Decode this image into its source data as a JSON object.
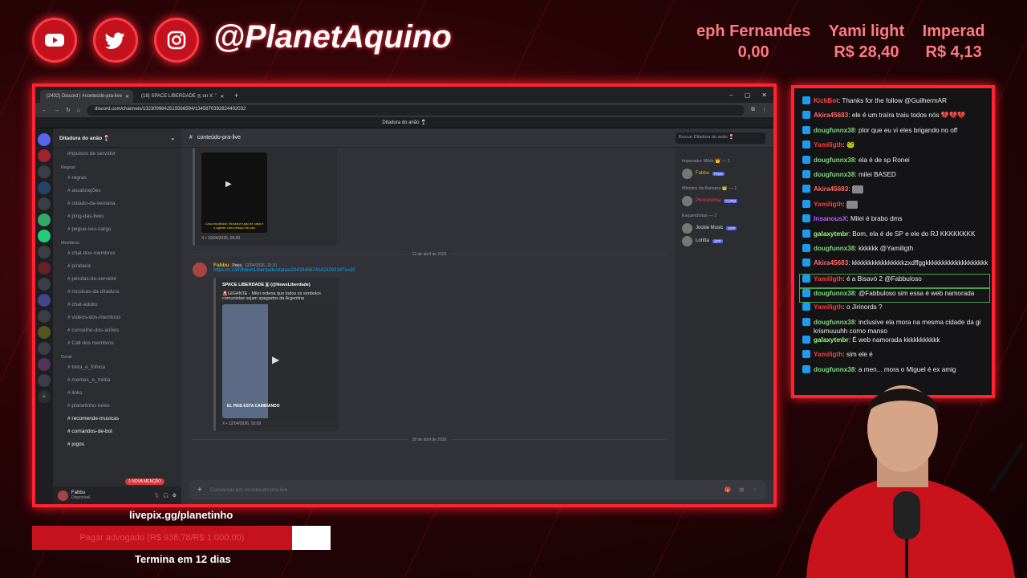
{
  "socials": [
    "youtube-icon",
    "twitter-icon",
    "instagram-icon"
  ],
  "handle": "@PlanetAquino",
  "ticker": [
    {
      "name": "eph Fernandes",
      "amount": "0,00"
    },
    {
      "name": "Yami light",
      "amount": "R$ 28,40"
    },
    {
      "name": "Imperad",
      "amount": "R$ 4,13"
    }
  ],
  "browser": {
    "tabs": [
      "(2402) Discord | #conteúdo-pra-live",
      "(18) SPACE LIBERDADE 🇦 on X: \""
    ],
    "url": "discord.com/channels/1323099842515566594/1345670392824402032",
    "title": "Ditadura do anão 🍷"
  },
  "discord": {
    "guild": "Ditadura do anão 🍷",
    "boost": "Impulsos de servidor",
    "categories": [
      {
        "name": "Regras",
        "channels": [
          "regras",
          "atualizações",
          "odiado-da-semana",
          "ping-das-lives",
          "pegue-seu-cargo"
        ]
      },
      {
        "name": "Membros",
        "channels": [
          "chat-dos-membros",
          "pirataria",
          "pérolas-do-servidor",
          "músicas-da-ditadura",
          "chat-adulto",
          "vídeos-dos-membros",
          "conselho-dos-anões",
          "Call dos membros"
        ]
      },
      {
        "name": "Geral",
        "channels": [
          "treta_e_fofoca",
          "memes_e_mídia",
          "links",
          "planetinho-news",
          "recomende-musicas",
          "comandos-de-bot",
          "jogos"
        ]
      }
    ],
    "mention": "1 NOVA MENÇÃO",
    "user": {
      "name": "Fabbu",
      "status": "Disponível"
    },
    "channel": "conteúdo-pra-live",
    "search": "Buscar Ditadura do anão 🍷",
    "messages": {
      "embed1_caption": "Caso insolitado: Morador fugiu de casa e o agente com pedaço de pau",
      "embed1_footer": "X • 10/04/2026, 09:00",
      "date1": "12 de abril de 2026",
      "author": "Fabbu",
      "tag": "Pepa",
      "time": "12/04/2026, 11:10",
      "link": "https://x.com/NewsLiberdade/status/2043345674142429214?s=20",
      "embed_title": "SPACE LIBERDADE 🇦 (@NewsLiberdade)",
      "embed_text": "🚨GIGANTE - Milei ordena que todos os símbolos comunistas sejam apagados da Argentina",
      "image_caption": "EL PAIS ESTA CAMBIANDO",
      "embed2_footer": "X • 12/04/2026, 10:09",
      "date2": "18 de abril de 2026"
    },
    "composer": "Conversar em #conteúdo-pra-live",
    "member_groups": [
      {
        "title": "Imperador Mildo 👑 — 1",
        "members": [
          {
            "name": "Fabbu",
            "tag": "Pepa",
            "color": "#f0b232"
          }
        ]
      },
      {
        "title": "Ministro da Baixaria 👑 — 1",
        "members": [
          {
            "name": "Princesinha",
            "tag": "CLRM",
            "color": "#f23f42"
          }
        ]
      },
      {
        "title": "Esquerdistas — 2",
        "members": [
          {
            "name": "Jockie Music",
            "tag": "APP",
            "color": "#dbdee1"
          },
          {
            "name": "Loritta",
            "tag": "APP",
            "color": "#dbdee1"
          }
        ]
      }
    ]
  },
  "chat": [
    {
      "user": "KickBot",
      "color": "#ff4a4a",
      "text": "Thanks for the follow @GuilhermAR"
    },
    {
      "user": "Akira45683",
      "color": "#ff6a6a",
      "text": "ele é um traíra traiu todos nós 💔💔💔"
    },
    {
      "user": "dougfunnx38",
      "color": "#7ed87e",
      "text": "plor que eu vi eles brigando no off"
    },
    {
      "user": "Yamiligth",
      "color": "#ff3a3a",
      "text": "🐸"
    },
    {
      "user": "dougfunnx38",
      "color": "#7ed87e",
      "text": "ela é de sp Ronei"
    },
    {
      "user": "dougfunnx38",
      "color": "#7ed87e",
      "text": "milei BASED"
    },
    {
      "user": "Akira45683",
      "color": "#ff6a6a",
      "text": ""
    },
    {
      "user": "Yamiligth",
      "color": "#ff3a3a",
      "text": ""
    },
    {
      "user": "InsanousX",
      "color": "#b45cff",
      "text": "Milei é brabo dms"
    },
    {
      "user": "galaxytmbr",
      "color": "#9aff7a",
      "text": "Bom, ela é de SP e ele do RJ KKKKKKKK"
    },
    {
      "user": "dougfunnx38",
      "color": "#7ed87e",
      "text": "kkkkkk @Yamiligth"
    },
    {
      "user": "Akira45683",
      "color": "#ff6a6a",
      "text": "kkkkkkkkkkkkkkkkzxdffggkkkkkkkkkkkkkkkkkkk"
    },
    {
      "user": "Yamiligth",
      "color": "#ff3a3a",
      "text": "é a Bisavó 2 @Fabbuloso",
      "hl": true
    },
    {
      "user": "dougfunnx38",
      "color": "#7ed87e",
      "text": "@Fabbuloso sim essa é web namorada",
      "hl": true
    },
    {
      "user": "Yamiligth",
      "color": "#ff3a3a",
      "text": "o Jirinords ?"
    },
    {
      "user": "dougfunnx38",
      "color": "#7ed87e",
      "text": "inclusive ela mora na mesma cidade da gi krismuuuhh corno manso"
    },
    {
      "user": "galaxytmbr",
      "color": "#9aff7a",
      "text": "É web namorada kkkkkkkkkkk"
    },
    {
      "user": "Yamiligth",
      "color": "#ff3a3a",
      "text": "sim ele é"
    },
    {
      "user": "dougfunnx38",
      "color": "#7ed87e",
      "text": "a men... mora o Miguel é ex amig"
    }
  ],
  "donation": {
    "site": "livepix.gg/planetinho",
    "goal_text": "Pagar advogado (R$ 938,78/R$ 1.000,00)",
    "progress": 0.94,
    "deadline": "Termina em 12 dias"
  }
}
